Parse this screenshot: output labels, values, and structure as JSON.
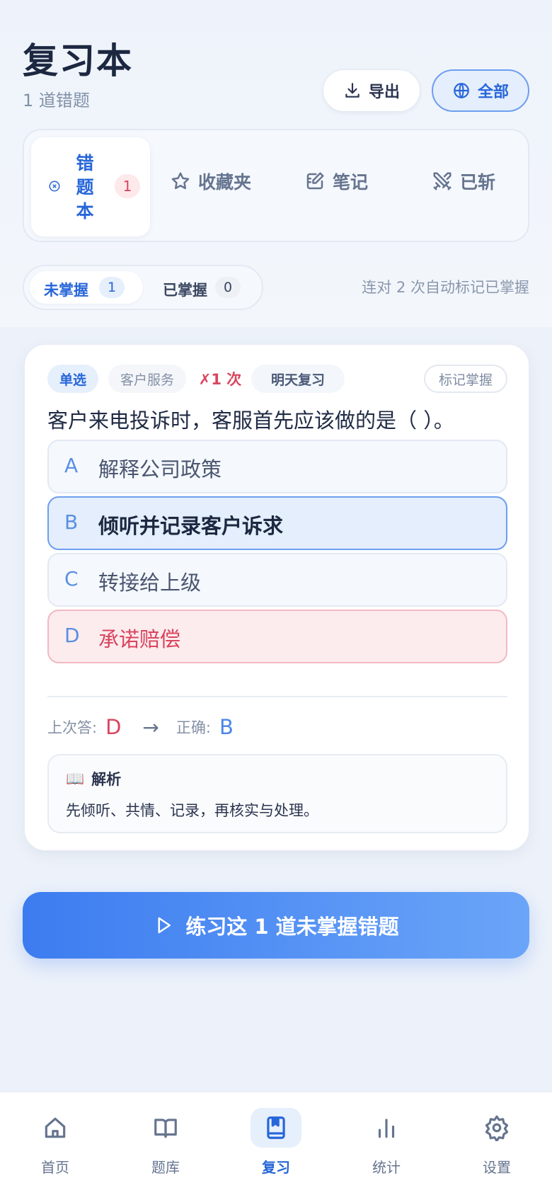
{
  "header": {
    "title": "复习本",
    "subtitle": "1 道错题",
    "export_label": "导出",
    "scope_label": "全部"
  },
  "tabs": {
    "active": {
      "label_chars": [
        "错",
        "题",
        "本"
      ],
      "count": "1",
      "icon": "circle-x-icon"
    },
    "items": [
      {
        "label": "收藏夹",
        "icon": "star-icon"
      },
      {
        "label": "笔记",
        "icon": "note-edit-icon"
      },
      {
        "label": "已斩",
        "icon": "swords-icon"
      }
    ]
  },
  "filter": {
    "unmastered_label": "未掌握",
    "unmastered_count": "1",
    "mastered_label": "已掌握",
    "mastered_count": "0",
    "hint": "连对 2 次自动标记已掌握"
  },
  "question": {
    "type": "单选",
    "category": "客户服务",
    "wrong_count": "✗1 次",
    "review": "明天复习",
    "mark_mastered": "标记掌握",
    "text": "客户来电投诉时，客服首先应该做的是（ ）。",
    "options": [
      {
        "letter": "A",
        "text": "解释公司政策",
        "state": "normal"
      },
      {
        "letter": "B",
        "text": "倾听并记录客户诉求",
        "state": "correct"
      },
      {
        "letter": "C",
        "text": "转接给上级",
        "state": "normal"
      },
      {
        "letter": "D",
        "text": "承诺赔偿",
        "state": "wrong"
      }
    ],
    "last_answer_label": "上次答:",
    "last_answer": "D",
    "arrow": "→",
    "correct_label": "正确:",
    "correct_answer": "B",
    "explanation_title": "解析",
    "explanation_icon": "📖",
    "explanation": "先倾听、共情、记录，再核实与处理。"
  },
  "practice_button": "练习这 1 道未掌握错题",
  "nav": [
    {
      "label": "首页",
      "icon": "home-icon"
    },
    {
      "label": "题库",
      "icon": "book-open-icon"
    },
    {
      "label": "复习",
      "icon": "bookmark-book-icon"
    },
    {
      "label": "统计",
      "icon": "bar-chart-icon"
    },
    {
      "label": "设置",
      "icon": "gear-icon"
    }
  ],
  "colors": {
    "accent": "#2766d9",
    "error": "#d9455f",
    "correct": "#4a86e8"
  }
}
